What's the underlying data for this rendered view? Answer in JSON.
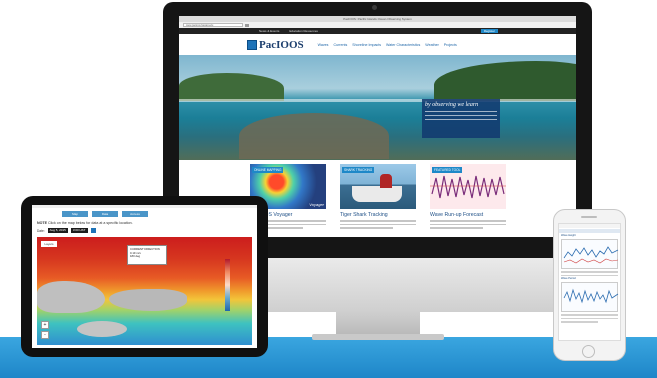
{
  "imac": {
    "browser_title": "PacIOOS: Pacific Islands Ocean Observing System",
    "url": "www.pacioos.hawaii.edu",
    "top_nav": [
      "News & Events",
      "Education Resources",
      "Register"
    ],
    "logo": "PacIOOS",
    "main_nav": [
      "Waves",
      "Currents",
      "Shoreline Impacts",
      "Water Characteristics",
      "Weather",
      "Projects"
    ],
    "hero_caption": "by observing we learn",
    "cards": [
      {
        "badge": "ONLINE MAPPING",
        "title": "PacIOOS Voyager",
        "overlay": "Voyager"
      },
      {
        "badge": "SHARK TRACKING",
        "title": "Tiger Shark Tracking"
      },
      {
        "badge": "FEATURED TOOL",
        "title": "Wave Run-up Forecast"
      }
    ]
  },
  "ipad": {
    "tabs": [
      "Map",
      "Data",
      "Access"
    ],
    "note_label": "NOTE",
    "note_text": "Click on the map below for data at a specific location.",
    "date_label": "Date:",
    "date_value": "Aug 5, 2015",
    "time_value": "3:00 HST",
    "popup": [
      "CURRENT DIRECTION",
      "0.19 m/s",
      "180 deg"
    ],
    "map_button": "Layers",
    "zoom_in": "+",
    "zoom_out": "-"
  },
  "iphone": {
    "chart_title": "Wave Height",
    "chart2_title": "Wave Period"
  },
  "colors": {
    "band": "#1e86c8",
    "accent": "#1e88c8",
    "navy": "#1d3f6e"
  }
}
